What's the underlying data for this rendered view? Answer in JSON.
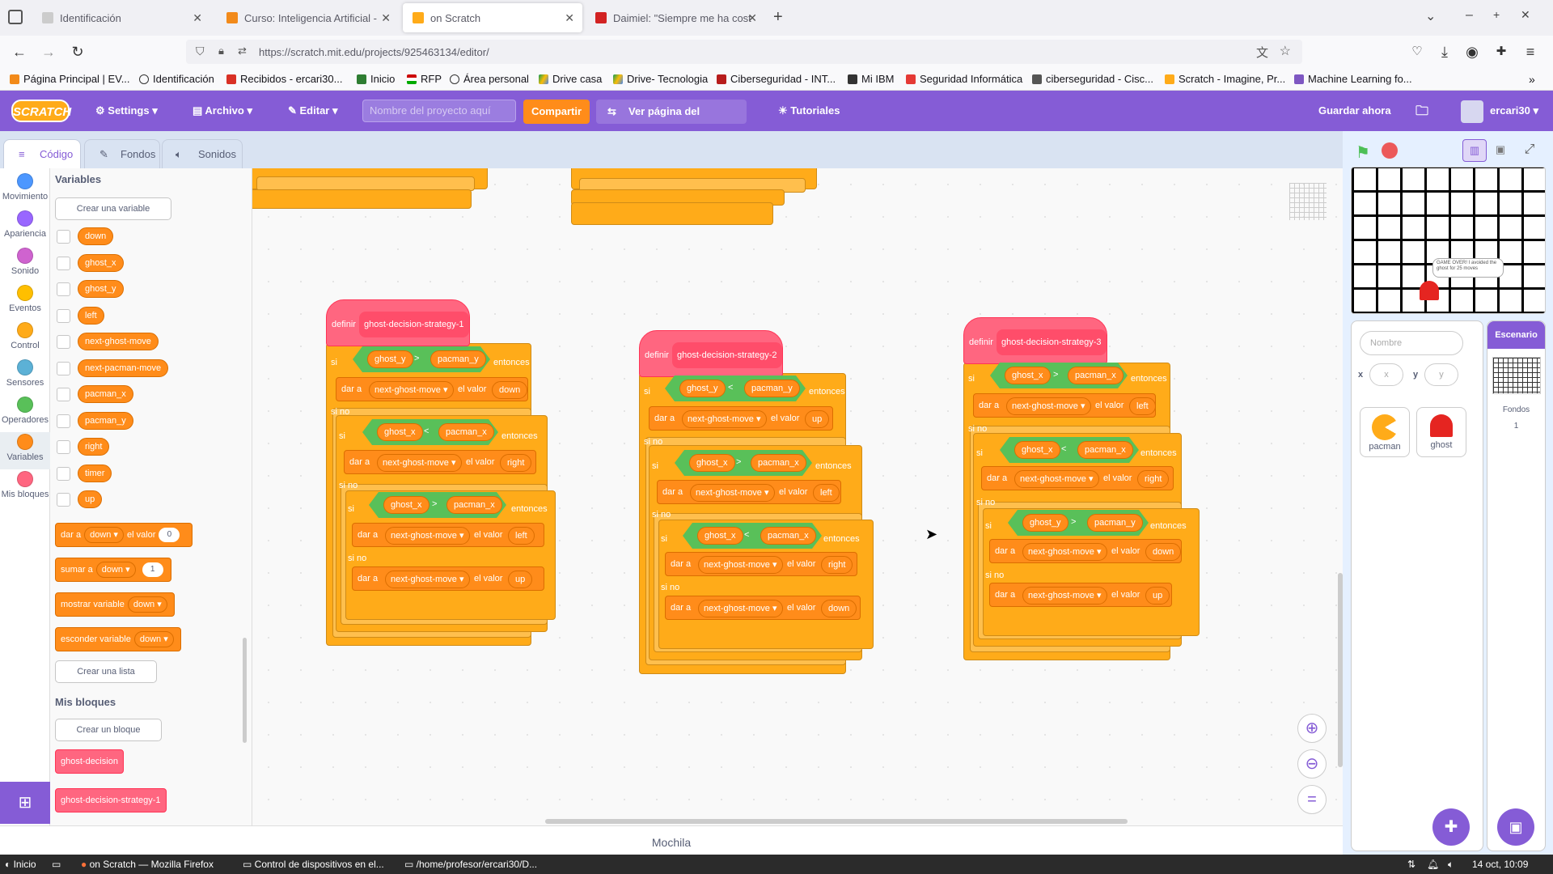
{
  "browser": {
    "tabs": [
      {
        "label": "Identificación",
        "color": "#cccccc"
      },
      {
        "label": "Curso: Inteligencia Artificial -",
        "color": "#f28a1a"
      },
      {
        "label": "on Scratch",
        "color": "#ffab19"
      },
      {
        "label": "Daimiel: \"Siempre me ha cost",
        "color": "#d22222"
      }
    ],
    "url": "https://scratch.mit.edu/projects/925463134/editor/",
    "bookmarks": [
      "Página Principal | EV...",
      "Identificación",
      "Recibidos - ercari30...",
      "Inicio",
      "RFP",
      "Área personal",
      "Drive casa",
      "Drive- Tecnologia",
      "Ciberseguridad - INT...",
      "Mi IBM",
      "Seguridad Informática",
      "ciberseguridad - Cisc...",
      "Scratch - Imagine, Pr...",
      "Machine Learning fo..."
    ]
  },
  "menu": {
    "logo": "SCRATCH",
    "settings": "Settings",
    "archivo": "Archivo",
    "editar": "Editar",
    "project_placeholder": "Nombre del proyecto aquí",
    "share": "Compartir",
    "view_page": "Ver página del proyecto",
    "tutorials": "Tutoriales",
    "save_now": "Guardar ahora",
    "user": "ercari30"
  },
  "editor_tabs": [
    "Código",
    "Fondos",
    "Sonidos"
  ],
  "categories": [
    {
      "label": "Movimiento",
      "color": "#4c97ff"
    },
    {
      "label": "Apariencia",
      "color": "#9966ff"
    },
    {
      "label": "Sonido",
      "color": "#cf63cf"
    },
    {
      "label": "Eventos",
      "color": "#ffbf00"
    },
    {
      "label": "Control",
      "color": "#ffab19"
    },
    {
      "label": "Sensores",
      "color": "#5cb1d6"
    },
    {
      "label": "Operadores",
      "color": "#59c059"
    },
    {
      "label": "Variables",
      "color": "#ff8c1a"
    },
    {
      "label": "Mis bloques",
      "color": "#ff6680"
    }
  ],
  "palette": {
    "variables_title": "Variables",
    "create_variable": "Crear una variable",
    "variables": [
      "down",
      "ghost_x",
      "ghost_y",
      "left",
      "next-ghost-move",
      "next-pacman-move",
      "pacman_x",
      "pacman_y",
      "right",
      "timer",
      "up"
    ],
    "set_block": {
      "t1": "dar a",
      "var": "down",
      "t2": "el valor",
      "val": "0"
    },
    "change_block": {
      "t1": "sumar a",
      "var": "down",
      "val": "1"
    },
    "show_block": {
      "t1": "mostrar variable",
      "var": "down"
    },
    "hide_block": {
      "t1": "esconder variable",
      "var": "down"
    },
    "create_list": "Crear una lista",
    "myblocks_title": "Mis bloques",
    "create_block": "Crear un bloque",
    "myblocks": [
      "ghost-decision",
      "ghost-decision-strategy-1"
    ]
  },
  "scripts": {
    "define": "definir",
    "if": "si",
    "then": "entonces",
    "else": "si no",
    "set": "dar a",
    "to": "el valor",
    "var": "next-ghost-move",
    "strategy1": {
      "name": "ghost-decision-strategy-1",
      "c1": {
        "a": "ghost_y",
        "op": ">",
        "b": "pacman_y"
      },
      "v1": "down",
      "c2": {
        "a": "ghost_x",
        "op": "<",
        "b": "pacman_x"
      },
      "v2": "right",
      "c3": {
        "a": "ghost_x",
        "op": ">",
        "b": "pacman_x"
      },
      "v3": "left",
      "v4": "up"
    },
    "strategy2": {
      "name": "ghost-decision-strategy-2",
      "c1": {
        "a": "ghost_y",
        "op": "<",
        "b": "pacman_y"
      },
      "v1": "up",
      "c2": {
        "a": "ghost_x",
        "op": ">",
        "b": "pacman_x"
      },
      "v2": "left",
      "c3": {
        "a": "ghost_x",
        "op": "<",
        "b": "pacman_x"
      },
      "v3": "right",
      "v4": "down"
    },
    "strategy3": {
      "name": "ghost-decision-strategy-3",
      "c1": {
        "a": "ghost_x",
        "op": ">",
        "b": "pacman_x"
      },
      "v1": "left",
      "c2": {
        "a": "ghost_x",
        "op": "<",
        "b": "pacman_x"
      },
      "v2": "right",
      "c3": {
        "a": "ghost_y",
        "op": ">",
        "b": "pacman_y"
      },
      "v3": "down",
      "v4": "up"
    }
  },
  "stage": {
    "speech": "GAME OVER! I avoided the ghost for 25 moves"
  },
  "sprite_info": {
    "name_placeholder": "Nombre",
    "x_label": "x",
    "x_placeholder": "x",
    "y_label": "y",
    "y_placeholder": "y"
  },
  "sprites": [
    "pacman",
    "ghost"
  ],
  "stage_panel": {
    "title": "Escenario",
    "backdrops_label": "Fondos",
    "backdrops_count": "1"
  },
  "backpack": "Mochila",
  "taskbar": {
    "start": "Inicio",
    "items": [
      "on Scratch — Mozilla Firefox",
      "Control de dispositivos en el...",
      "/home/profesor/ercari30/D..."
    ],
    "clock": "14 oct, 10:09"
  }
}
